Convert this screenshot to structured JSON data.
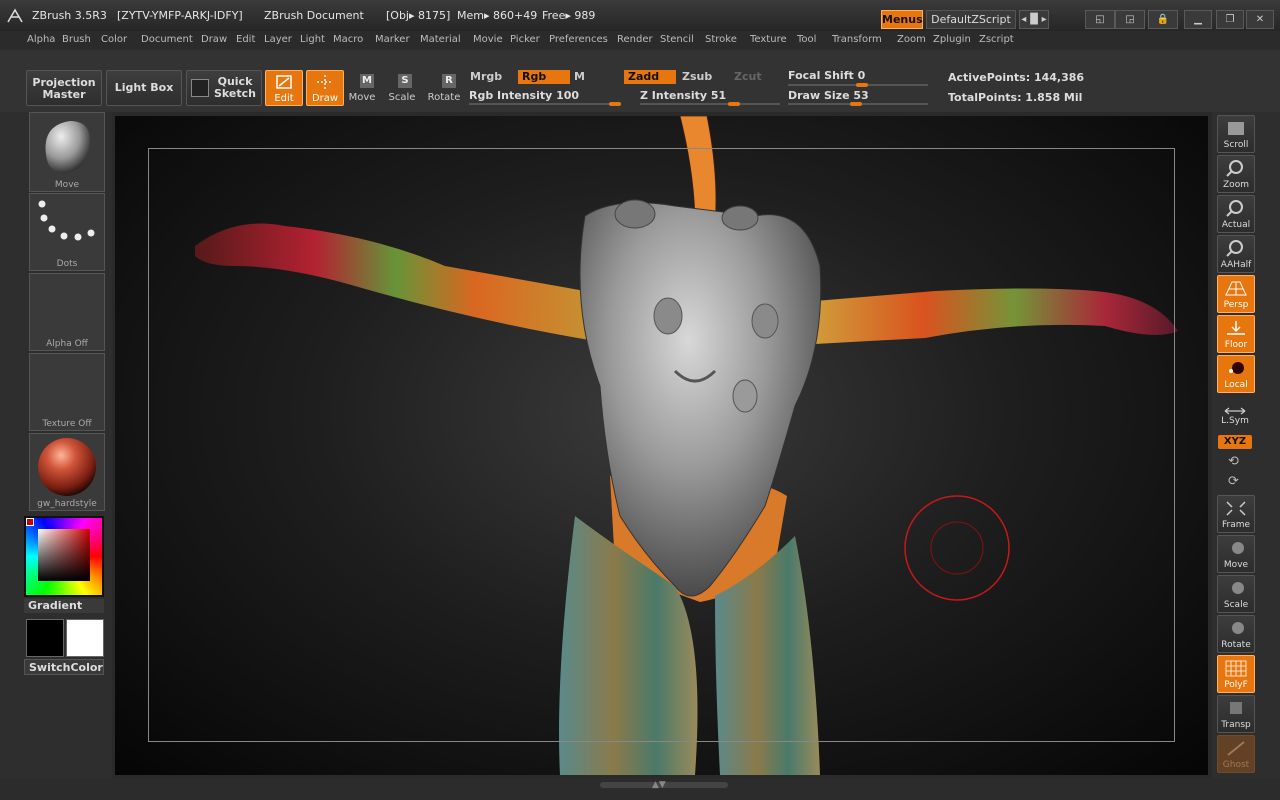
{
  "titlebar": {
    "app": "ZBrush 3.5R3",
    "serial": "[ZYTV-YMFP-ARKJ-IDFY]",
    "doc": "ZBrush Document",
    "obj": "[Obj▸ 8175]",
    "mem": "Mem▸ 860+49",
    "free": "Free▸ 989",
    "menus": "Menus",
    "script": "DefaultZScript"
  },
  "menubar": [
    "Alpha",
    "Brush",
    "Color",
    "Document",
    "Draw",
    "Edit",
    "Layer",
    "Light",
    "Macro",
    "Marker",
    "Material",
    "Movie",
    "Picker",
    "Preferences",
    "Render",
    "Stencil",
    "Stroke",
    "Texture",
    "Tool",
    "Transform",
    "Zoom",
    "Zplugin",
    "Zscript"
  ],
  "shelf": {
    "projection_master": [
      "Projection",
      "Master"
    ],
    "light_box": "Light Box",
    "quick_sketch": [
      "Quick",
      "Sketch"
    ],
    "edit": "Edit",
    "draw": "Draw",
    "move": "Move",
    "scale": "Scale",
    "rotate": "Rotate",
    "move_key": "M",
    "scale_key": "S",
    "rotate_key": "R",
    "mrgb": "Mrgb",
    "rgb": "Rgb",
    "m": "M",
    "zadd": "Zadd",
    "zsub": "Zsub",
    "zcut": "Zcut",
    "rgb_intensity_label": "Rgb Intensity",
    "rgb_intensity": "100",
    "z_intensity_label": "Z Intensity",
    "z_intensity": "51",
    "focal_shift_label": "Focal Shift",
    "focal_shift": "0",
    "draw_size_label": "Draw Size",
    "draw_size": "53",
    "active_points": "ActivePoints: 144,386",
    "total_points": "TotalPoints: 1.858 Mil"
  },
  "left": {
    "brush": "Move",
    "stroke": "Dots",
    "alpha": "Alpha Off",
    "texture": "Texture Off",
    "material": "gw_hardstyle",
    "gradient": "Gradient",
    "switch": "SwitchColor"
  },
  "right": [
    "Scroll",
    "Zoom",
    "Actual",
    "AAHalf",
    "Persp",
    "Floor",
    "Local",
    "L.Sym",
    "XYZ",
    "Frame",
    "Move",
    "Scale",
    "Rotate",
    "PolyF",
    "Transp",
    "Ghost"
  ],
  "colors": {
    "accent": "#e8760e",
    "bg": "#2a2a2a",
    "panel": "#333333"
  }
}
